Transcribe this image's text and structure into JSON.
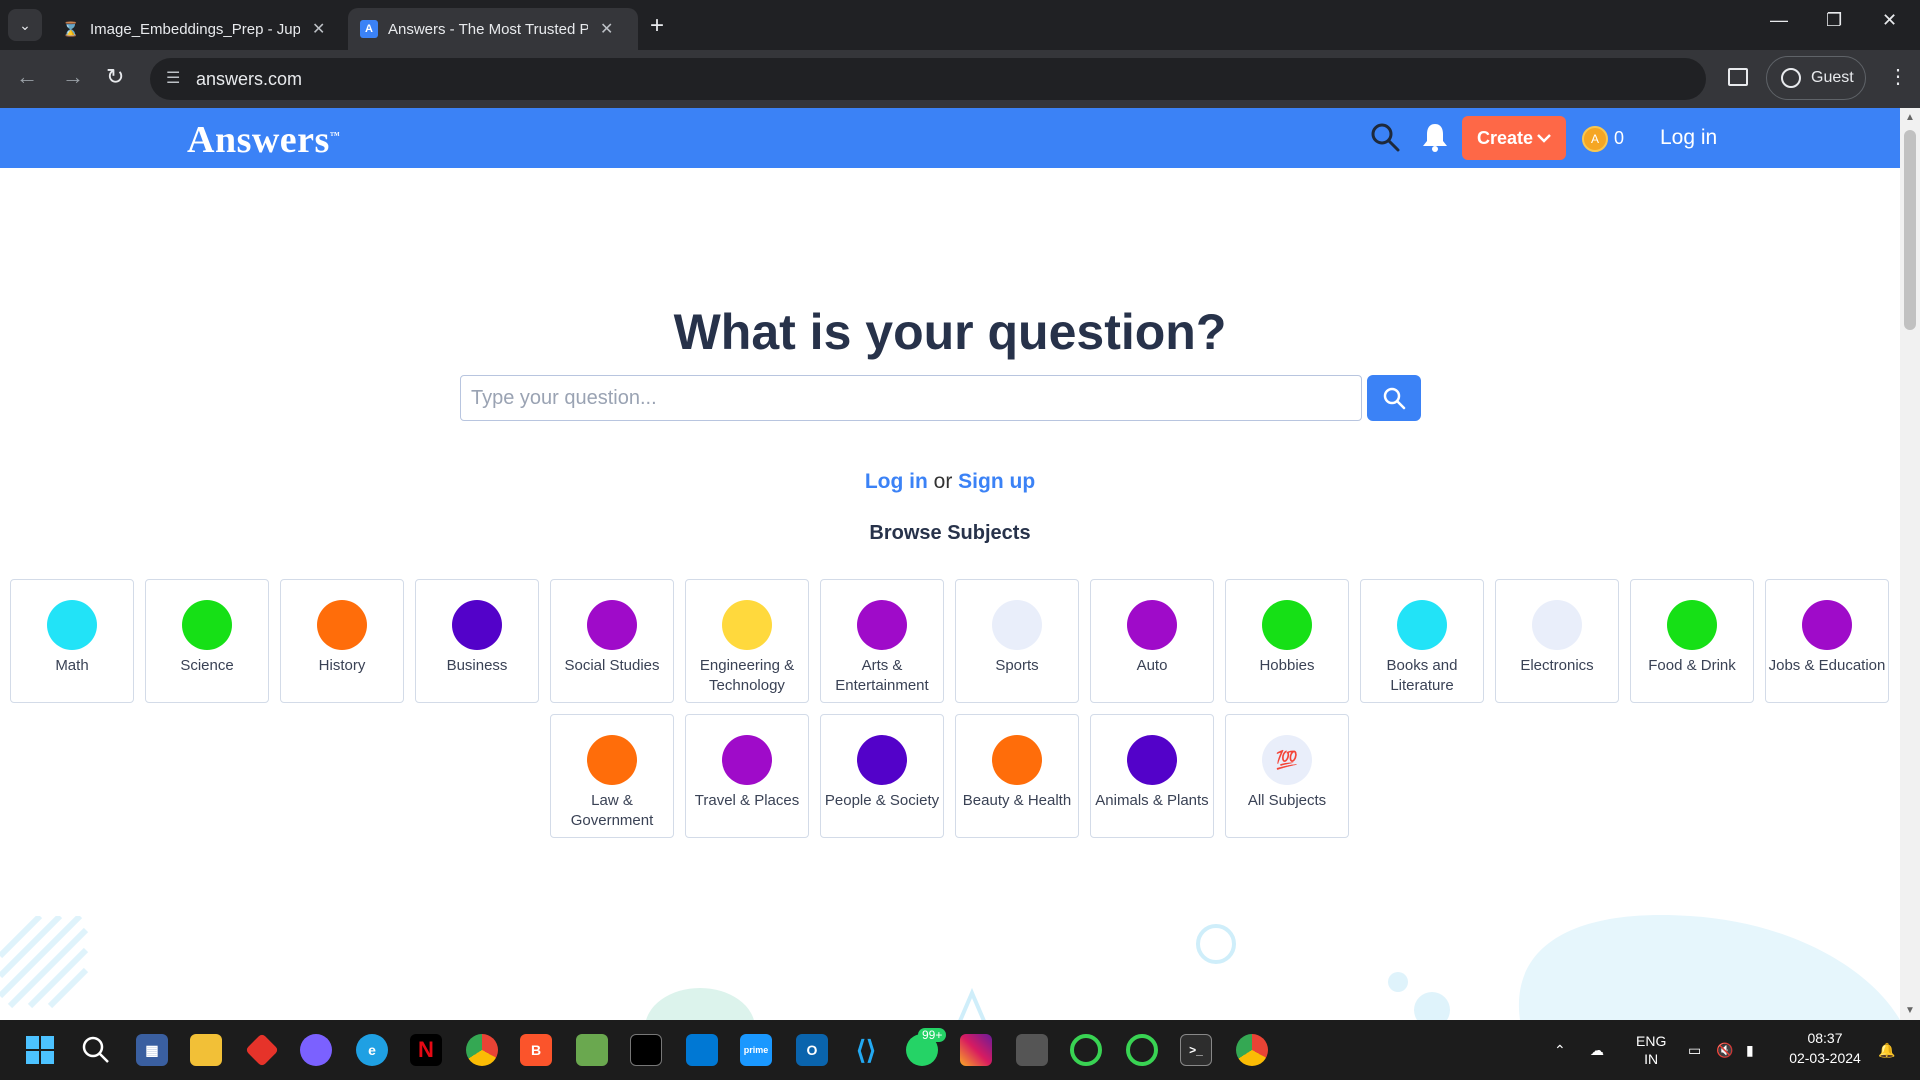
{
  "browser": {
    "tabs": [
      {
        "title": "Image_Embeddings_Prep - Jupy",
        "icon": "hourglass-icon",
        "active": false
      },
      {
        "title": "Answers - The Most Trusted Pla",
        "icon": "answers-favicon",
        "active": true
      }
    ],
    "address": "answers.com",
    "profile_label": "Guest"
  },
  "site_header": {
    "logo": "Answers",
    "logo_tm": "™",
    "create_label": "Create",
    "coin_count": "0",
    "login_label": "Log in",
    "brand_color": "#3b82f6",
    "create_color": "#fe6847"
  },
  "hero": {
    "title": "What is your question?",
    "placeholder": "Type your question..."
  },
  "auth": {
    "login": "Log in",
    "or": "or",
    "signup": "Sign up"
  },
  "browse_title": "Browse Subjects",
  "subjects": [
    {
      "label": "Math",
      "color": "#22e3f7"
    },
    {
      "label": "Science",
      "color": "#16e016"
    },
    {
      "label": "History",
      "color": "#ff6d0a"
    },
    {
      "label": "Business",
      "color": "#5302c9"
    },
    {
      "label": "Social Studies",
      "color": "#9f0bc9"
    },
    {
      "label": "Engineering & Technology",
      "color": "#ffd93d"
    },
    {
      "label": "Arts & Entertainment",
      "color": "#9f0bc9"
    },
    {
      "label": "Sports",
      "color": "#e9eefa"
    },
    {
      "label": "Auto",
      "color": "#9f0bc9"
    },
    {
      "label": "Hobbies",
      "color": "#16e016"
    },
    {
      "label": "Books and Literature",
      "color": "#22e3f7"
    },
    {
      "label": "Electronics",
      "color": "#e9eefa"
    },
    {
      "label": "Food & Drink",
      "color": "#16e016"
    },
    {
      "label": "Jobs & Education",
      "color": "#9f0bc9"
    },
    {
      "label": "Law & Government",
      "color": "#ff6d0a"
    },
    {
      "label": "Travel & Places",
      "color": "#9f0bc9"
    },
    {
      "label": "People & Society",
      "color": "#5302c9"
    },
    {
      "label": "Beauty & Health",
      "color": "#ff6d0a"
    },
    {
      "label": "Animals & Plants",
      "color": "#5302c9"
    },
    {
      "label": "All Subjects",
      "color": "#e9eefa",
      "glyph": "💯"
    }
  ],
  "taskbar": {
    "badge_whatsapp": "99+",
    "lang_top": "ENG",
    "lang_bottom": "IN",
    "time": "08:37",
    "date": "02-03-2024"
  }
}
